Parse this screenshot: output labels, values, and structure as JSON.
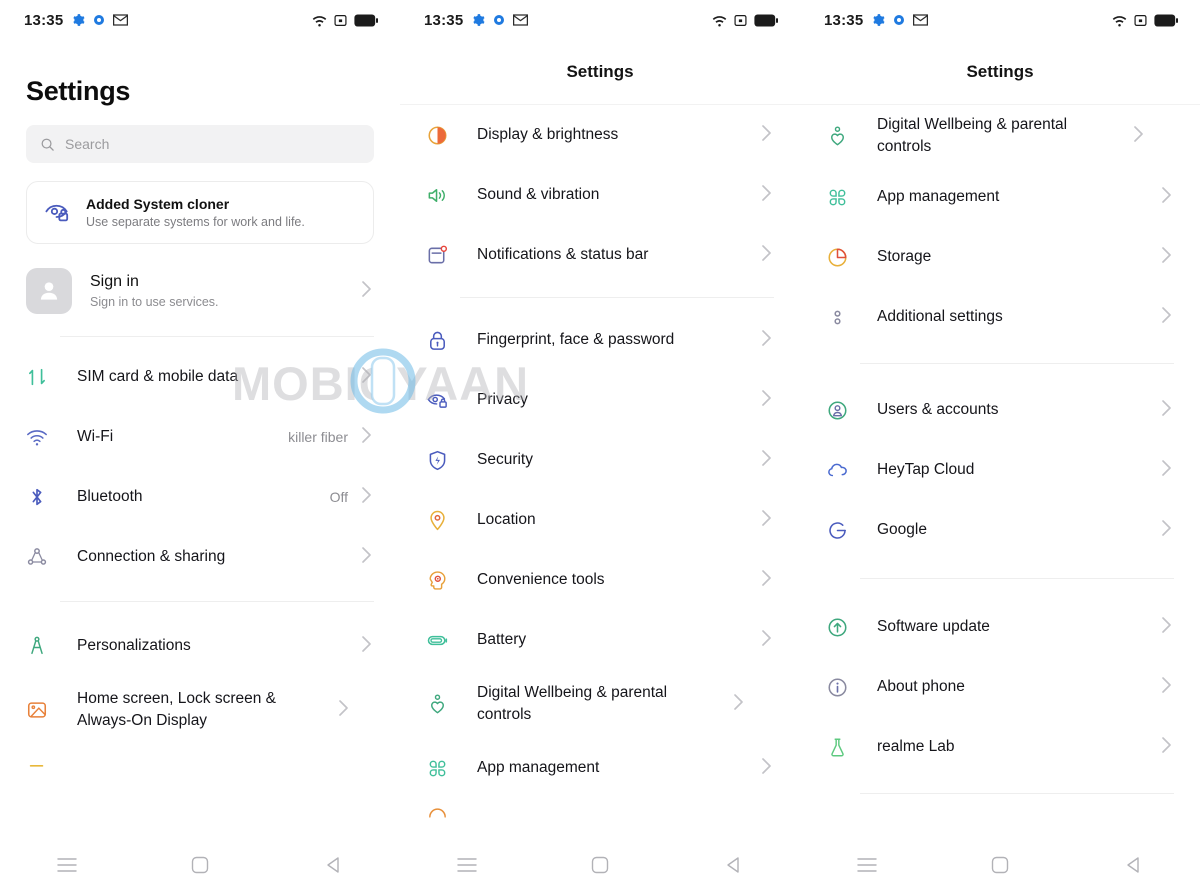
{
  "statusbar": {
    "time": "13:35",
    "left_icons": [
      "gear-icon",
      "dot-icon",
      "gmail-icon"
    ],
    "right_icons": [
      "wifi-icon",
      "cast-icon",
      "battery-icon"
    ]
  },
  "navbar": {
    "menu_label": "menu-icon",
    "home_label": "home-icon",
    "back_label": "back-icon"
  },
  "watermark": {
    "text": "MOBIGYAAN"
  },
  "panel1": {
    "title": "Settings",
    "search": {
      "placeholder": "Search",
      "icon": "search-icon"
    },
    "promo": {
      "icon": "system-cloner-icon",
      "title": "Added System cloner",
      "subtitle": "Use separate systems for work and life."
    },
    "account": {
      "icon": "avatar-person-icon",
      "title": "Sign in",
      "subtitle": "Sign in to use services."
    },
    "items": [
      {
        "icon": "sim-card-icon",
        "label": "SIM card & mobile data",
        "value": ""
      },
      {
        "icon": "wifi-icon",
        "label": "Wi-Fi",
        "value": "killer fiber"
      },
      {
        "icon": "bluetooth-icon",
        "label": "Bluetooth",
        "value": "Off"
      },
      {
        "icon": "connection-share-icon",
        "label": "Connection & sharing",
        "value": ""
      },
      {
        "icon": "personalization-icon",
        "label": "Personalizations",
        "value": ""
      },
      {
        "icon": "home-lockscreen-icon",
        "label": "Home screen, Lock screen & Always-On Display",
        "value": ""
      }
    ]
  },
  "panel2": {
    "title": "Settings",
    "items": [
      {
        "icon": "display-brightness-icon",
        "label": "Display & brightness"
      },
      {
        "icon": "sound-vibration-icon",
        "label": "Sound & vibration"
      },
      {
        "icon": "notifications-icon",
        "label": "Notifications & status bar"
      },
      {
        "icon": "fingerprint-lock-icon",
        "label": "Fingerprint, face & password"
      },
      {
        "icon": "privacy-icon",
        "label": "Privacy"
      },
      {
        "icon": "security-shield-icon",
        "label": "Security"
      },
      {
        "icon": "location-pin-icon",
        "label": "Location"
      },
      {
        "icon": "convenience-tools-icon",
        "label": "Convenience tools"
      },
      {
        "icon": "battery-icon",
        "label": "Battery"
      },
      {
        "icon": "digital-wellbeing-icon",
        "label": "Digital Wellbeing & parental controls"
      },
      {
        "icon": "app-management-icon",
        "label": "App management"
      }
    ]
  },
  "panel3": {
    "title": "Settings",
    "items": [
      {
        "icon": "digital-wellbeing-icon",
        "label": "Digital Wellbeing & parental controls"
      },
      {
        "icon": "app-management-icon",
        "label": "App management"
      },
      {
        "icon": "storage-icon",
        "label": "Storage"
      },
      {
        "icon": "additional-settings-icon",
        "label": "Additional settings"
      },
      {
        "icon": "users-accounts-icon",
        "label": "Users & accounts"
      },
      {
        "icon": "heytap-cloud-icon",
        "label": "HeyTap Cloud"
      },
      {
        "icon": "google-icon",
        "label": "Google"
      },
      {
        "icon": "software-update-icon",
        "label": "Software update"
      },
      {
        "icon": "about-phone-icon",
        "label": "About phone"
      },
      {
        "icon": "realme-lab-icon",
        "label": "realme Lab"
      }
    ]
  },
  "colors": {
    "accent_blue": "#4a5bbd",
    "green": "#3fbf9a",
    "orange": "#e8813a",
    "yellow": "#e8b83a",
    "red": "#e05b4a",
    "text": "#15151a",
    "muted": "#8d8d92"
  }
}
